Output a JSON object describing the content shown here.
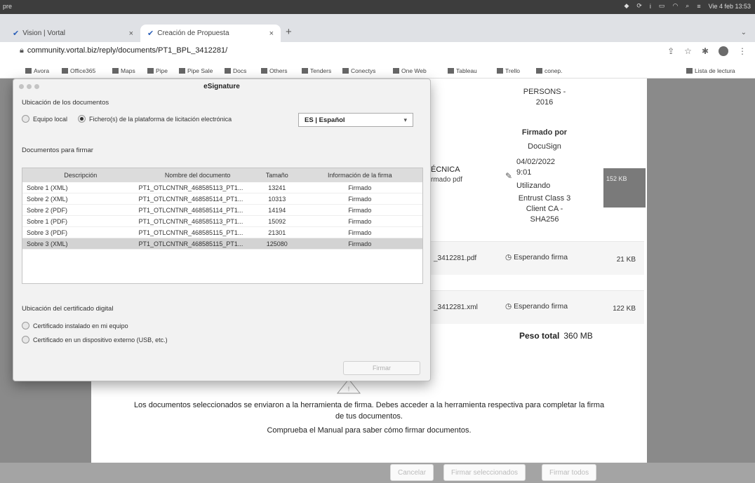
{
  "os_bar": {
    "app": "pre",
    "clock": "Vie 4 feb 13:53"
  },
  "tabs": [
    {
      "label": "Vision | Vortal"
    },
    {
      "label": "Creación de Propuesta"
    }
  ],
  "address": {
    "url": "community.vortal.biz/reply/documents/PT1_BPL_3412281/"
  },
  "bookmarks": [
    "Avora",
    "Office365",
    "Maps",
    "Pipe",
    "Pipe Sale",
    "Docs",
    "Others",
    "Tenders",
    "Conectys",
    "One Web",
    "Tableau",
    "Trello",
    "conep.",
    "Lista de lectura"
  ],
  "page": {
    "sig_info": {
      "persons": "PERSONS -\n2016",
      "firmado_por": "Firmado por",
      "signer": "DocuSign",
      "date": "04/02/2022\n9:01",
      "utilizando": "Utilizando",
      "cert": "Entrust Class 3\nClient CA -\nSHA256"
    },
    "tecnica": {
      "title": "ÉCNICA",
      "sub": "rmado pdf"
    },
    "chip": "152 KB",
    "rows": [
      {
        "file": "_3412281.pdf",
        "status": "Esperando firma",
        "size": "21 KB"
      },
      {
        "file": "_3412281.xml",
        "status": "Esperando firma",
        "size": "122 KB"
      }
    ],
    "total_label": "Peso total",
    "total_value": "360 MB",
    "message_line1": "Los documentos seleccionados se enviaron a la herramienta de firma. Debes acceder a la herramienta respectiva para completar la firma",
    "message_line2": "de tus documentos.",
    "message_line3": "Comprueba el Manual para saber cómo firmar documentos.",
    "buttons": {
      "cancel": "Cancelar",
      "sign_selected": "Firmar seleccionados",
      "sign_all": "Firmar todos"
    }
  },
  "dialog": {
    "title": "eSignature",
    "location_label": "Ubicación de los documentos",
    "option_local": "Equipo local",
    "option_platform": "Fichero(s) de la plataforma de licitación electrónica",
    "language": "ES | Español",
    "docs_label": "Documentos para firmar",
    "columns": [
      "Descripción",
      "Nombre del documento",
      "Tamaño",
      "Información de la firma"
    ],
    "rows": [
      [
        "Sobre 1 (XML)",
        "PT1_OTLCNTNR_468585113_PT1...",
        "13241",
        "Firmado"
      ],
      [
        "Sobre 2 (XML)",
        "PT1_OTLCNTNR_468585114_PT1...",
        "10313",
        "Firmado"
      ],
      [
        "Sobre 2 (PDF)",
        "PT1_OTLCNTNR_468585114_PT1...",
        "14194",
        "Firmado"
      ],
      [
        "Sobre 1 (PDF)",
        "PT1_OTLCNTNR_468585113_PT1...",
        "15092",
        "Firmado"
      ],
      [
        "Sobre 3 (PDF)",
        "PT1_OTLCNTNR_468585115_PT1...",
        "21301",
        "Firmado"
      ],
      [
        "Sobre 3 (XML)",
        "PT1_OTLCNTNR_468585115_PT1...",
        "125080",
        "Firmado"
      ]
    ],
    "cert_label": "Ubicación del certificado digital",
    "cert_option1": "Certificado instalado en mi equipo",
    "cert_option2": "Certificado en un dispositivo externo (USB, etc.)",
    "sign_button": "Firmar"
  }
}
